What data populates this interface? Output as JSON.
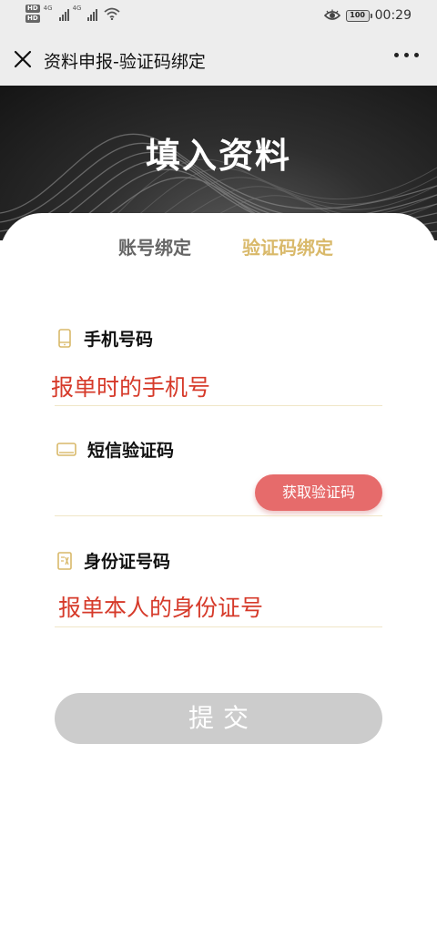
{
  "status_bar": {
    "hd_badges": [
      "HD",
      "HD"
    ],
    "signal_labels": [
      "4G",
      "4G"
    ],
    "battery": "100",
    "time": "00:29"
  },
  "nav": {
    "title": "资料申报-验证码绑定",
    "close_icon": "close-icon",
    "more_icon": "more-icon"
  },
  "banner": {
    "title": "填入资料"
  },
  "tabs": [
    {
      "label": "账号绑定",
      "active": false
    },
    {
      "label": "验证码绑定",
      "active": true
    }
  ],
  "form": {
    "phone": {
      "label": "手机号码",
      "value": "报单时的手机号",
      "icon": "phone-icon"
    },
    "sms": {
      "label": "短信验证码",
      "value": "",
      "icon": "message-icon",
      "button": "获取验证码"
    },
    "id": {
      "label": "身份证号码",
      "value": "报单本人的身份证号",
      "icon": "id-card-icon"
    }
  },
  "submit_label": "提交",
  "colors": {
    "active_tab": "#d9b96a",
    "value_text": "#d63a2a",
    "code_button": "#e66b6b",
    "submit_disabled": "#cccccc"
  }
}
